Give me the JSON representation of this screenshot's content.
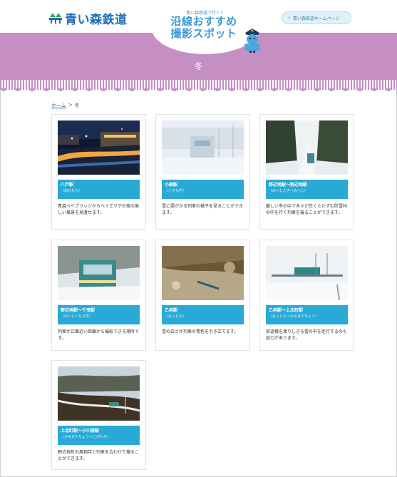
{
  "header": {
    "logo_text": "青い森鉄道",
    "hp_link_label": "青い森鉄道ホームページ"
  },
  "feature": {
    "subtitle": "青い森鉄道で行く！",
    "title_line1": "沿線おすすめ",
    "title_line2": "撮影スポット"
  },
  "season": "冬",
  "breadcrumb": {
    "home": "ホーム",
    "separator": ">",
    "current": "冬"
  },
  "spots": [
    {
      "name": "八戸駅",
      "reading": "（あおもり）",
      "desc": "青森ベイブリッジからベイエリアの夜の美しい風景を見渡せます。",
      "photo": "night"
    },
    {
      "name": "小柳駅",
      "reading": "（こやなぎ）",
      "desc": "雪に霞がかる列車の様子を見ることができます。",
      "photo": "snow"
    },
    {
      "name": "野辺地駅〜野辺地駅",
      "reading": "（のへじえき〜のへじ）",
      "desc": "厳しい冬の中で木々が白くたたずむ防雪林の中を行く列車を撮ることができます。",
      "photo": "forest"
    },
    {
      "name": "野辺地駅〜千曳駅",
      "reading": "（のへじ〜ちびき）",
      "desc": "列車が正面近い距離から撮影できる場所です。",
      "photo": "train-front"
    },
    {
      "name": "乙供駅",
      "reading": "（おっとも）",
      "desc": "雪の白さが列車の青色を引き立てます。",
      "photo": "hill"
    },
    {
      "name": "乙供駅〜上北町駅",
      "reading": "（おっとも〜かみきたちょう）",
      "desc": "鉄道橋を渡りしきる雪の中を走行するのも迫力があります。",
      "photo": "bridge"
    },
    {
      "name": "上北町駅〜小川原駅",
      "reading": "（かみきたちょう〜こがわら）",
      "desc": "野辺地町の風物詩と列車を合わせて撮ることができます。",
      "photo": "valley"
    }
  ],
  "colors": {
    "brand": "#1d6fb8",
    "band": "#c58fc4",
    "label": "#29a9d6"
  }
}
